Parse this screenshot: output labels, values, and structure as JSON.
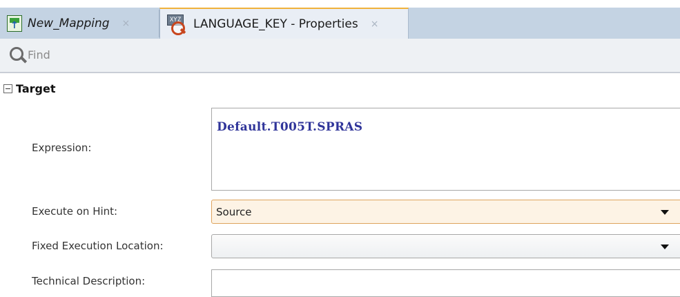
{
  "tabs": [
    {
      "label": "New_Mapping",
      "icon": "mapping-icon",
      "active": false
    },
    {
      "label": "LANGUAGE_KEY - Properties",
      "icon": "properties-icon",
      "active": true
    }
  ],
  "tab_close_glyph": "×",
  "find": {
    "placeholder": "Find",
    "value": ""
  },
  "section": {
    "title": "Target",
    "collapsed": false
  },
  "form": {
    "expression_label": "Expression:",
    "expression_value": "Default.T005T.SPRAS",
    "execute_on_hint_label": "Execute on Hint:",
    "execute_on_hint_value": "Source",
    "fixed_execution_location_label": "Fixed Execution Location:",
    "fixed_execution_location_value": "",
    "technical_description_label": "Technical Description:",
    "technical_description_value": ""
  },
  "colors": {
    "tab_strip": "#c4d3e3",
    "active_tab_accent": "#f0b13a",
    "expression_text": "#30359a",
    "active_select_bg": "#fdf3e5"
  }
}
